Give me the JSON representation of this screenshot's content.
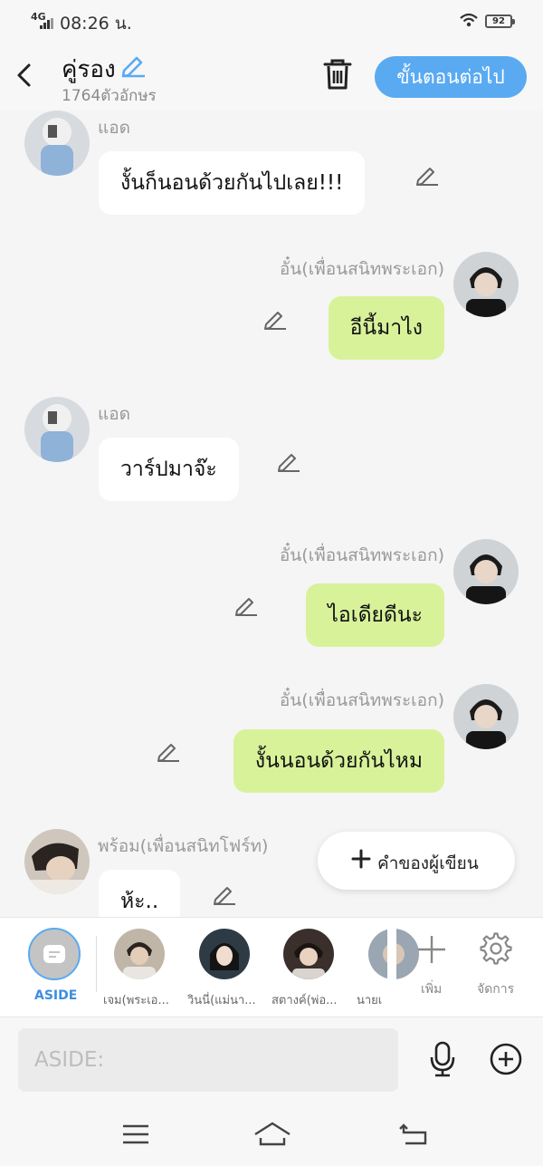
{
  "status_bar": {
    "network": "4G",
    "time": "08:26 น.",
    "battery": "92"
  },
  "header": {
    "title": "คู่รอง",
    "subtitle": "1764ตัวอักษร",
    "next_button": "ขั้นตอนต่อไป",
    "accent_color": "#5aaaf2"
  },
  "messages": [
    {
      "side": "left",
      "name": "แอด",
      "text": "งั้นก็นอนด้วยกันไปเลย!!!"
    },
    {
      "side": "right",
      "name": "อั๋น(เพื่อนสนิทพระเอก)",
      "text": "อีนี้มาไง"
    },
    {
      "side": "left",
      "name": "แอด",
      "text": "วาร์ปมาจ๊ะ"
    },
    {
      "side": "right",
      "name": "อั๋น(เพื่อนสนิทพระเอก)",
      "text": "ไอเดียดีนะ"
    },
    {
      "side": "right",
      "name": "อั๋น(เพื่อนสนิทพระเอก)",
      "text": "งั้นนอนด้วยกันไหม"
    },
    {
      "side": "left",
      "name": "พร้อม(เพื่อนสนิทโฟร์ท)",
      "text": "ห้ะ.."
    }
  ],
  "fab": {
    "label": "คำของผู้เขียน"
  },
  "character_bar": {
    "aside_label": "ASIDE",
    "characters": [
      {
        "name": "เจม(พระเอ..."
      },
      {
        "name": "วินนี่(แม่นา..."
      },
      {
        "name": "สตางค์(พ่อ..."
      },
      {
        "name": "นายเ"
      }
    ],
    "add_label": "เพิ่ม",
    "manage_label": "จัดการ"
  },
  "input_bar": {
    "placeholder": "ASIDE:"
  }
}
